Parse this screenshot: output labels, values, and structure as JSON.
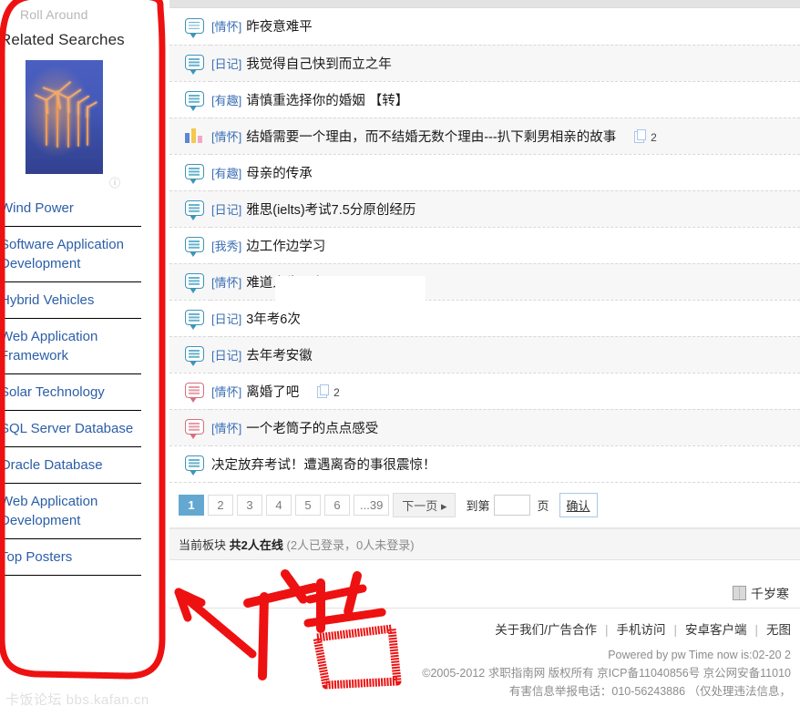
{
  "sidebar": {
    "roll_around_label": "Roll Around",
    "related_searches_title": "Related Searches",
    "ad_caption": "Wind Power",
    "ad_info_icon": "info-icon",
    "items": [
      {
        "label": "Software Application Development"
      },
      {
        "label": "Hybrid Vehicles"
      },
      {
        "label": "Web Application Framework"
      },
      {
        "label": "Solar Technology"
      },
      {
        "label": "SQL Server Database"
      },
      {
        "label": "Oracle Database"
      },
      {
        "label": "Web Application Development"
      },
      {
        "label": "Top Posters"
      }
    ]
  },
  "threads": [
    {
      "icon": "speech-bubble-icon",
      "icon_color": "teal",
      "category": "[情怀]",
      "title": "昨夜意难平",
      "attachment_count": "",
      "alt": false
    },
    {
      "icon": "speech-bubble-icon",
      "icon_color": "teal",
      "category": "[日记]",
      "title": "我觉得自己快到而立之年",
      "attachment_count": "",
      "alt": true
    },
    {
      "icon": "speech-bubble-icon",
      "icon_color": "teal",
      "category": "[有趣]",
      "title": "请慎重选择你的婚姻 【转】",
      "attachment_count": "",
      "alt": false
    },
    {
      "icon": "poll-bar-icon",
      "icon_color": "multi",
      "category": "[情怀]",
      "title": "结婚需要一个理由，而不结婚无数个理由---扒下剩男相亲的故事",
      "attachment_count": "2",
      "alt": true
    },
    {
      "icon": "speech-bubble-icon",
      "icon_color": "teal",
      "category": "[有趣]",
      "title": "母亲的传承",
      "attachment_count": "",
      "alt": false
    },
    {
      "icon": "speech-bubble-icon",
      "icon_color": "teal",
      "category": "[日记]",
      "title": "雅思(ielts)考试7.5分原创经历",
      "attachment_count": "",
      "alt": true
    },
    {
      "icon": "speech-bubble-icon",
      "icon_color": "teal",
      "category": "[我秀]",
      "title": "边工作边学习",
      "attachment_count": "",
      "alt": false
    },
    {
      "icon": "speech-bubble-icon",
      "icon_color": "teal",
      "category": "[情怀]",
      "title": "难道人生只有",
      "attachment_count": "",
      "alt": true
    },
    {
      "icon": "speech-bubble-icon",
      "icon_color": "teal",
      "category": "[日记]",
      "title": "3年考6次",
      "attachment_count": "",
      "alt": false
    },
    {
      "icon": "speech-bubble-icon",
      "icon_color": "teal",
      "category": "[日记]",
      "title": "去年考安徽",
      "attachment_count": "",
      "alt": true
    },
    {
      "icon": "speech-bubble-icon",
      "icon_color": "red",
      "category": "[情怀]",
      "title": "离婚了吧",
      "attachment_count": "2",
      "alt": false
    },
    {
      "icon": "speech-bubble-icon",
      "icon_color": "red",
      "category": "[情怀]",
      "title": "一个老筒子的点点感受",
      "attachment_count": "",
      "alt": true
    },
    {
      "icon": "speech-bubble-icon",
      "icon_color": "teal",
      "category": "",
      "title": "决定放弃考试！遭遇离奇的事很震惊！",
      "attachment_count": "",
      "alt": false
    }
  ],
  "pagination": {
    "pages": [
      "1",
      "2",
      "3",
      "4",
      "5",
      "6",
      "...39"
    ],
    "current": "1",
    "next_label": "下一页",
    "goto_prefix": "到第",
    "goto_suffix": "页",
    "goto_value": "",
    "confirm_label": "确认"
  },
  "online": {
    "prefix": "当前板块",
    "total": "共2人在线",
    "detail": "(2人已登录，0人未登录)"
  },
  "signature": {
    "icon": "book-icon",
    "name": "千岁寒"
  },
  "footer": {
    "links": [
      "关于我们/广告合作",
      "手机访问",
      "安卓客户端",
      "无图"
    ],
    "separator": "|",
    "powered": "Powered by pw  Time now is:02-20 2",
    "copyright": "©2005-2012 求职指南网 版权所有 京ICP备11040856号 京公网安备11010",
    "report": "有害信息举报电话：010-56243886 （仅处理违法信息，"
  },
  "watermark": "卡饭论坛 bbs.kafan.cn",
  "annotation": {
    "text": "广告",
    "color": "#ee1111",
    "shapes": [
      "ad-region-oval",
      "pointer-arrow",
      "handwritten-label"
    ]
  }
}
